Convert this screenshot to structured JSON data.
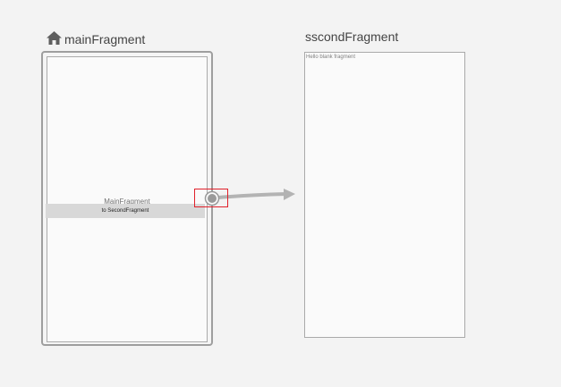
{
  "graph": {
    "start_destination_icon": "home-icon",
    "main_fragment": {
      "title": "mainFragment",
      "preview_label": "MainFragment",
      "button_label": "to SecondFragment"
    },
    "second_fragment": {
      "title": "sscondFragment",
      "preview_text": "Hello blank fragment"
    },
    "action": {
      "from": "mainFragment",
      "to": "sscondFragment",
      "highlight_color": "#e0202a",
      "line_color": "#b0b0b0"
    }
  }
}
